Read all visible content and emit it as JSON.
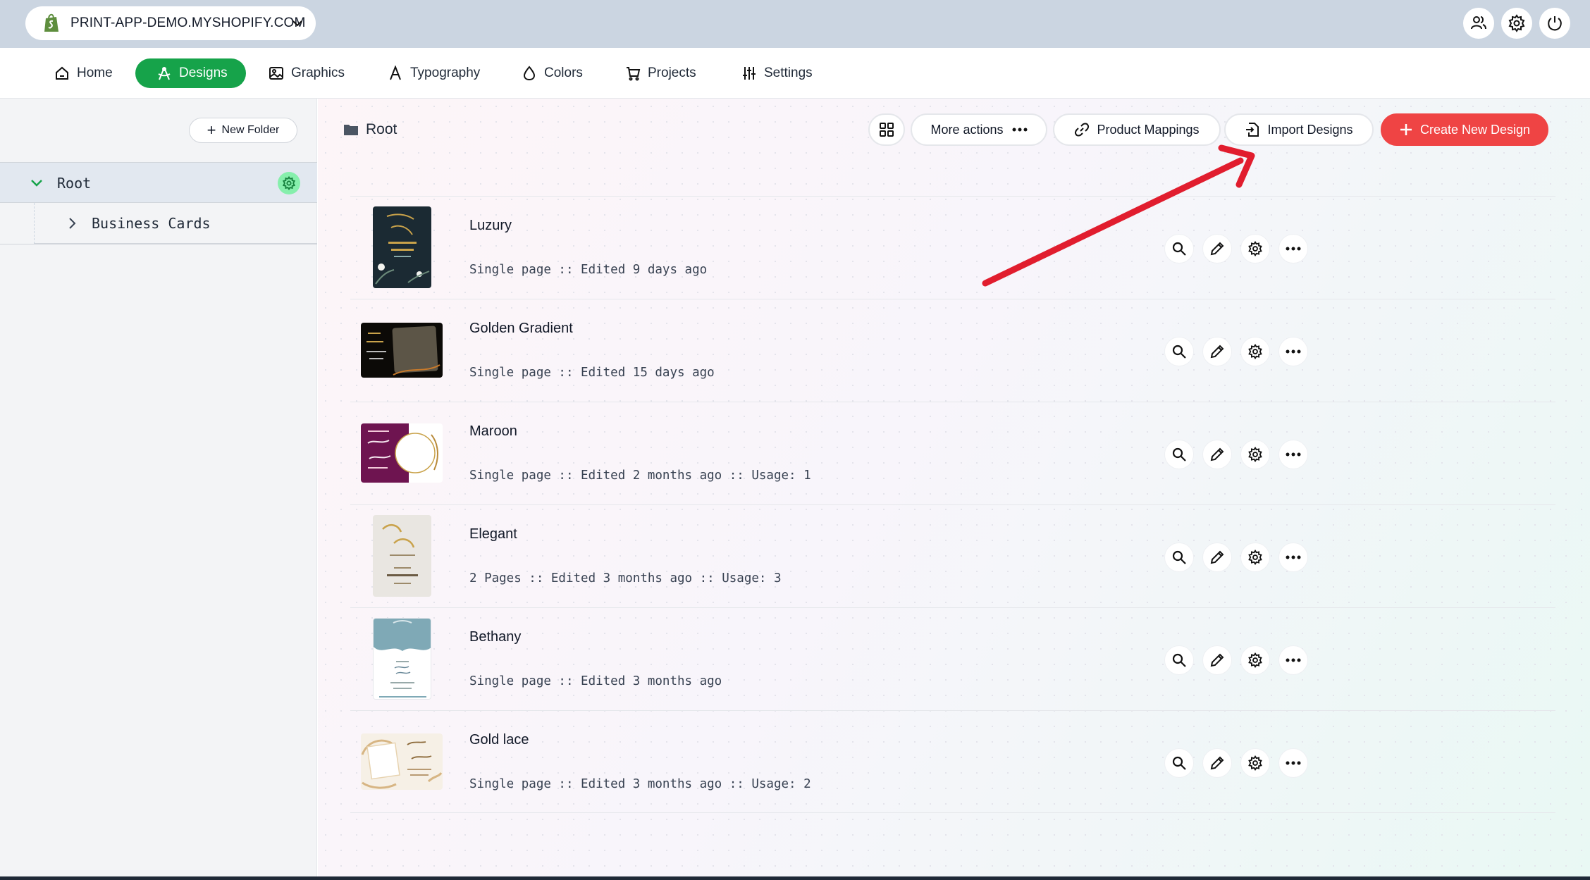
{
  "topbar": {
    "store_name": "PRINT-APP-DEMO.MYSHOPIFY.COM",
    "icons": [
      "users-icon",
      "gear-icon",
      "power-icon"
    ]
  },
  "nav": {
    "items": [
      {
        "label": "Home",
        "icon": "home-icon"
      },
      {
        "label": "Designs",
        "icon": "designs-icon",
        "active": true
      },
      {
        "label": "Graphics",
        "icon": "image-icon"
      },
      {
        "label": "Typography",
        "icon": "typography-icon"
      },
      {
        "label": "Colors",
        "icon": "droplet-icon"
      },
      {
        "label": "Projects",
        "icon": "cart-icon"
      },
      {
        "label": "Settings",
        "icon": "sliders-icon"
      }
    ]
  },
  "sidebar": {
    "new_folder_label": "New Folder",
    "root_label": "Root",
    "child_label": "Business Cards"
  },
  "main": {
    "breadcrumb": "Root",
    "toolbar": {
      "more_actions": "More actions",
      "product_mappings": "Product Mappings",
      "import_designs": "Import Designs",
      "create_new_design": "Create New Design"
    },
    "designs": [
      {
        "title": "Luzury",
        "meta": "Single page :: Edited 9 days ago"
      },
      {
        "title": "Golden Gradient",
        "meta": "Single page :: Edited 15 days ago"
      },
      {
        "title": "Maroon",
        "meta": "Single page :: Edited 2 months ago :: Usage: 1"
      },
      {
        "title": "Elegant",
        "meta": "2 Pages :: Edited 3 months ago :: Usage: 3"
      },
      {
        "title": "Bethany",
        "meta": "Single page :: Edited 3 months ago"
      },
      {
        "title": "Gold lace",
        "meta": "Single page :: Edited 3 months ago :: Usage: 2"
      }
    ]
  },
  "colors": {
    "accent_green": "#16a34a",
    "create_red": "#ef4444",
    "annotation_red": "#e11d2e"
  }
}
